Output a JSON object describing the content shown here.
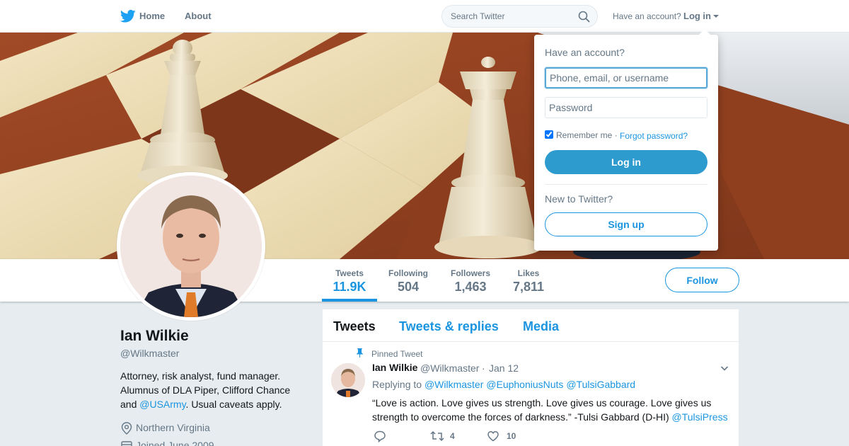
{
  "nav": {
    "home_label": "Home",
    "about_label": "About",
    "search_placeholder": "Search Twitter",
    "have_account": "Have an account?",
    "login_label": "Log in"
  },
  "profile": {
    "name": "Ian Wilkie",
    "handle": "@Wilkmaster",
    "bio_part1": "Attorney, risk analyst, fund manager. Alumnus of DLA Piper, Clifford Chance and ",
    "bio_link": "@USArmy",
    "bio_part2": ". Usual caveats apply.",
    "location": "Northern Virginia",
    "joined": "Joined June 2009"
  },
  "stats": [
    {
      "label": "Tweets",
      "value": "11.9K"
    },
    {
      "label": "Following",
      "value": "504"
    },
    {
      "label": "Followers",
      "value": "1,463"
    },
    {
      "label": "Likes",
      "value": "7,811"
    }
  ],
  "follow_label": "Follow",
  "timeline": {
    "tabs": [
      "Tweets",
      "Tweets & replies",
      "Media"
    ],
    "tweet": {
      "pinned_label": "Pinned Tweet",
      "author_name": "Ian Wilkie",
      "author_handle": "@Wilkmaster",
      "separator": "·",
      "date": "Jan 12",
      "replying_label": "Replying to",
      "replying_to": [
        "@Wilkmaster",
        "@EuphoniusNuts",
        "@TulsiGabbard"
      ],
      "text": "“Love is action. Love gives us strength. Love gives us courage. Love gives us strength to overcome the forces of darkness.” -Tulsi Gabbard (D-HI) ",
      "text_link": "@TulsiPress",
      "retweets": "4",
      "likes": "10"
    }
  },
  "login_dropdown": {
    "title": "Have an account?",
    "username_placeholder": "Phone, email, or username",
    "password_placeholder": "Password",
    "remember_label": "Remember me ·",
    "forgot_label": "Forgot password?",
    "login_button": "Log in",
    "new_label": "New to Twitter?",
    "signup_button": "Sign up"
  },
  "colors": {
    "accent": "#1b95e0",
    "login_button": "#2e9bcf",
    "background": "#e6ecf0"
  }
}
